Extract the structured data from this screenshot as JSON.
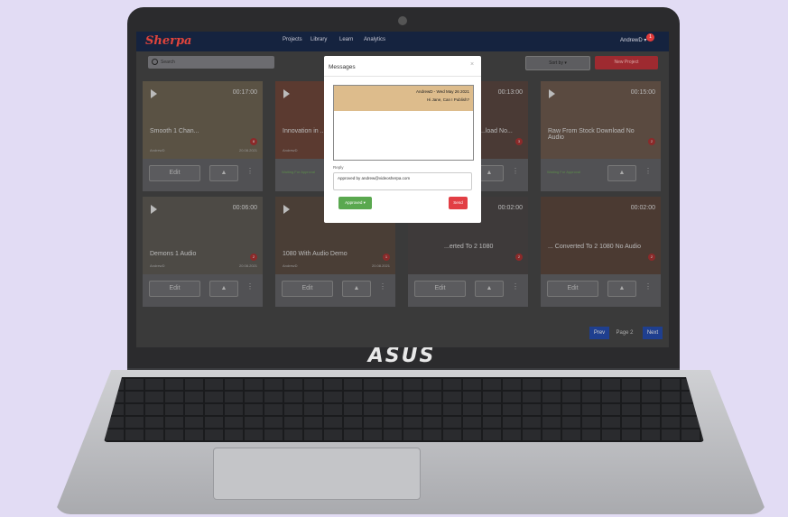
{
  "app": {
    "logo": "Sherpa"
  },
  "nav": {
    "items": [
      "Projects",
      "Library",
      "Learn",
      "Analytics"
    ],
    "user": "AndrewD ▾",
    "notifications": "1"
  },
  "toolbar": {
    "search_placeholder": "Search",
    "sort_label": "Sort by ▾",
    "new_project": "New Project"
  },
  "cards": [
    {
      "title": "Smooth 1 Chan...",
      "author": "AndrewD",
      "date": "20.08.2021",
      "duration": "00:17:00",
      "badge": "8",
      "action": "Edit",
      "status": ""
    },
    {
      "title": "Innovation in ...",
      "author": "AndrewD",
      "date": "",
      "duration": "",
      "badge": "",
      "action": "",
      "status": "Waiting For Approval"
    },
    {
      "title": "...load No...",
      "author": "",
      "date": "",
      "duration": "00:13:00",
      "badge": "3",
      "action": "",
      "status": ""
    },
    {
      "title": "Raw From Stock Download No Audio",
      "author": "",
      "date": "",
      "duration": "00:15:00",
      "badge": "2",
      "action": "",
      "status": "Waiting For Approval"
    },
    {
      "title": "Demons 1 Audio",
      "author": "AndrewD",
      "date": "20.08.2021",
      "duration": "00:06:00",
      "badge": "2",
      "action": "Edit",
      "status": ""
    },
    {
      "title": "1080 With Audio Demo",
      "author": "AndrewD",
      "date": "20.08.2021",
      "duration": "",
      "badge": "1",
      "action": "Edit",
      "status": ""
    },
    {
      "title": "...erted To 2 1080",
      "author": "",
      "date": "",
      "duration": "00:02:00",
      "badge": "2",
      "action": "Edit",
      "status": ""
    },
    {
      "title": "... Converted To 2 1080 No Audio",
      "author": "",
      "date": "",
      "duration": "00:02:00",
      "badge": "2",
      "action": "Edit",
      "status": ""
    }
  ],
  "pager": {
    "prev": "Prev",
    "page": "Page 2",
    "next": "Next"
  },
  "modal": {
    "title": "Messages",
    "close": "×",
    "message_header": "AndrewD - Wed May 26 2021",
    "message_body": "Hi Jane, Can I Publish?",
    "reply_label": "Reply",
    "reply_value": "Approved by andrew@videosherpa.com",
    "status_button": "Approved ▾",
    "send_button": "Send"
  },
  "laptop": {
    "brand": "ASUS"
  }
}
